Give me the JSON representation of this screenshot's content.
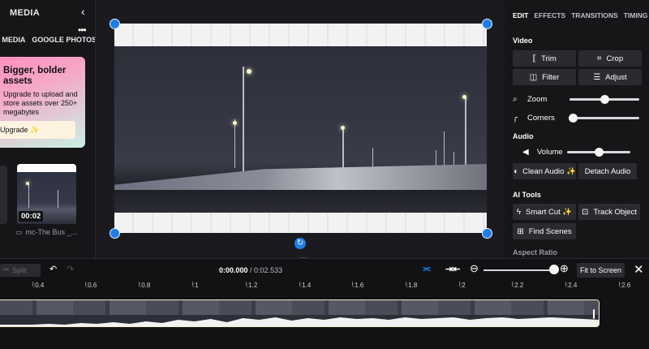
{
  "media_panel": {
    "title": "MEDIA",
    "tabs": [
      "Y MEDIA",
      "GOOGLE PHOTOS"
    ],
    "more": "•••",
    "promo": {
      "heading": "Bigger, bolder assets",
      "body": "Upgrade to upload and store assets over 250+ megabytes",
      "button": "Upgrade ✨"
    },
    "thumb": {
      "duration": "00:02",
      "label": "mc-The Bus _..."
    }
  },
  "edit_panel": {
    "tabs": [
      "EDIT",
      "EFFECTS",
      "TRANSITIONS",
      "TIMING"
    ],
    "video_label": "Video",
    "buttons": {
      "trim": "Trim",
      "crop": "Crop",
      "filter": "Filter",
      "adjust": "Adjust"
    },
    "zoom": {
      "label": "Zoom",
      "value": 0.5
    },
    "corners": {
      "label": "Corners",
      "value": 0.0
    },
    "audio_label": "Audio",
    "volume": {
      "label": "Volume",
      "value": 0.5
    },
    "clean_audio": "Clean Audio ✨",
    "detach_audio": "Detach Audio",
    "ai_tools_label": "AI Tools",
    "smart_cut": "Smart Cut ✨",
    "track_object": "Track Object",
    "find_scenes": "Find Scenes",
    "aspect_ratio": "Aspect Ratio"
  },
  "toolbar": {
    "split": "Split",
    "current_time": "0:00.000",
    "separator": " / ",
    "total_time": "0:02.533",
    "zoom_level": 0.93,
    "fit_to_screen": "Fit to Screen"
  },
  "timeline": {
    "ticks": [
      ":0.4",
      ":0.6",
      ":0.8",
      ":1",
      ":1.2",
      ":1.4",
      ":1.6",
      ":1.8",
      ":2",
      ":2.2",
      ":2.4",
      ":2.6"
    ]
  },
  "colors": {
    "accent": "#1f7de8",
    "clip_border": "#f2f0c8"
  }
}
